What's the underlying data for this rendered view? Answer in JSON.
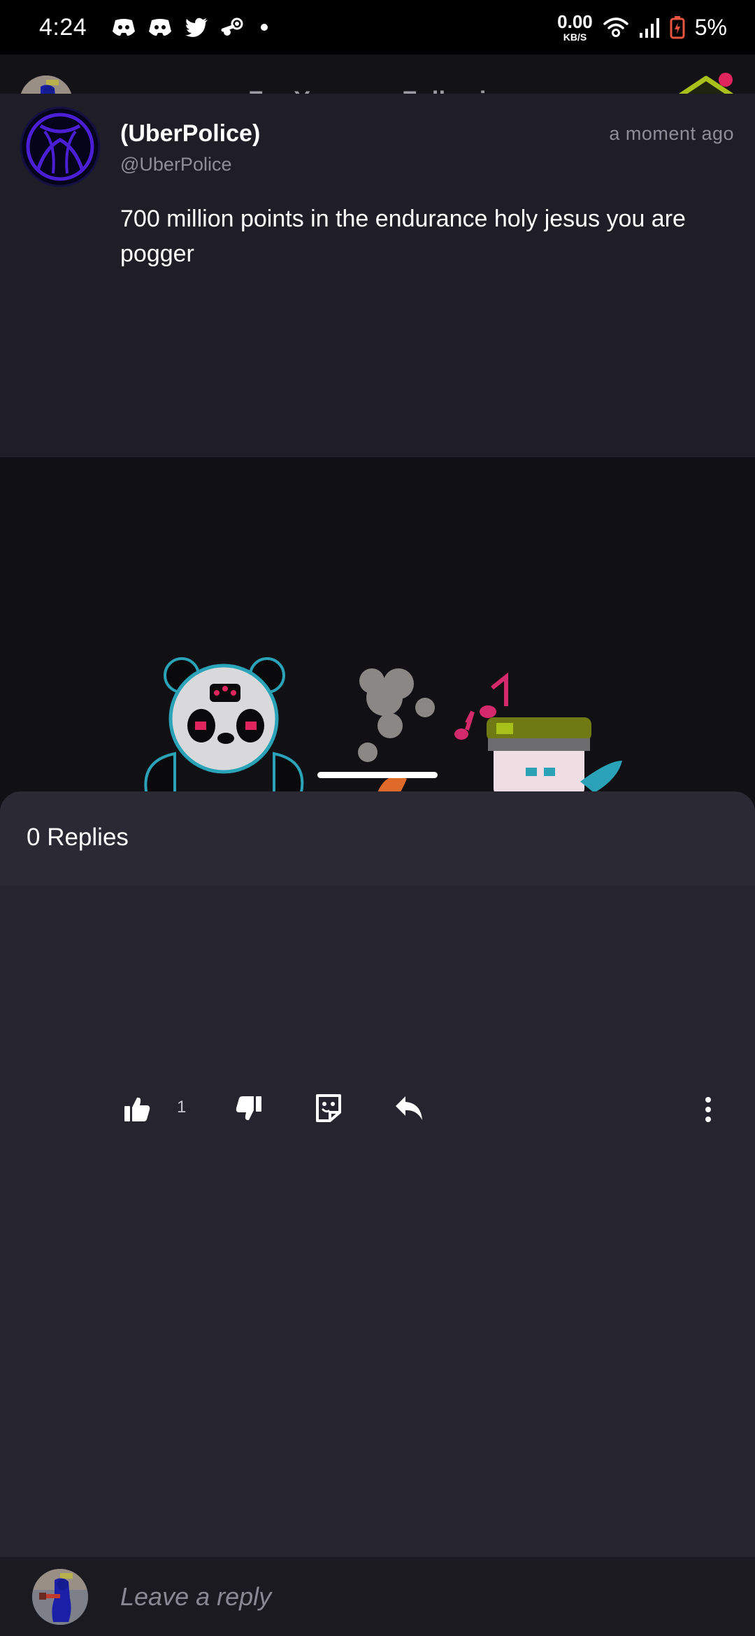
{
  "status_bar": {
    "time": "4:24",
    "net_speed": "0.00",
    "net_unit": "KB/S",
    "battery": "5%",
    "notification_icons": [
      "discord-icon",
      "discord-icon",
      "twitter-icon",
      "steam-icon",
      "dot-icon"
    ]
  },
  "header": {
    "tabs": [
      {
        "label": "For You",
        "active": true
      },
      {
        "label": "Following",
        "active": false
      }
    ],
    "badge_has_notification": true
  },
  "sheet": {
    "replies_title": "0 Replies",
    "comment": {
      "name": "(UberPolice)",
      "handle": "@UberPolice",
      "time": "a moment ago",
      "body": "700 million points in the endurance holy jesus you are pogger",
      "likes": "1"
    },
    "reply_placeholder": "Leave a reply"
  },
  "colors": {
    "background": "#111014",
    "sheet": "#26252f",
    "comment_bg": "#1f1e27",
    "badge_green": "#a8c11a",
    "badge_dot": "#e0245e",
    "xbox_purple": "#4b1fd6"
  }
}
